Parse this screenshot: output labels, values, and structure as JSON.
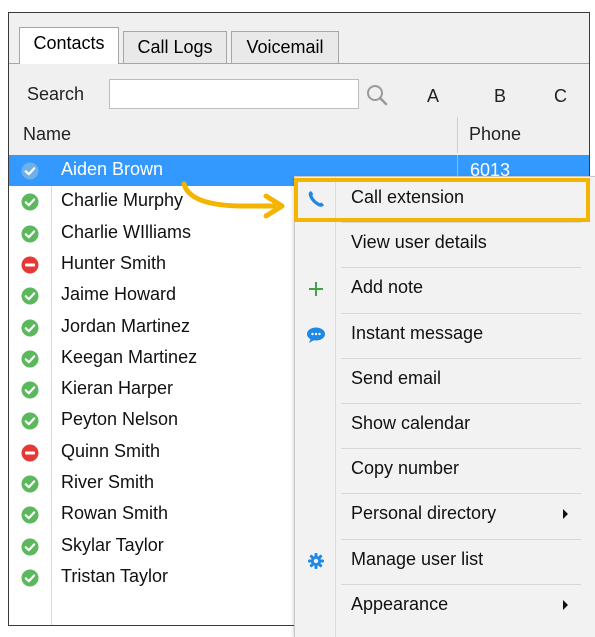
{
  "tabs": [
    {
      "label": "Contacts",
      "active": true
    },
    {
      "label": "Call Logs",
      "active": false
    },
    {
      "label": "Voicemail",
      "active": false
    }
  ],
  "search": {
    "label": "Search",
    "value": "",
    "placeholder": ""
  },
  "alphabet_index": [
    "A",
    "B",
    "C"
  ],
  "columns": {
    "name": "Name",
    "phone": "Phone"
  },
  "contacts": [
    {
      "name": "Aiden Brown",
      "status": "available",
      "phone": "6013",
      "selected": true
    },
    {
      "name": "Charlie Murphy",
      "status": "available"
    },
    {
      "name": "Charlie WIlliams",
      "status": "available"
    },
    {
      "name": "Hunter Smith",
      "status": "busy"
    },
    {
      "name": "Jaime Howard",
      "status": "available"
    },
    {
      "name": "Jordan Martinez",
      "status": "available"
    },
    {
      "name": "Keegan Martinez",
      "status": "available"
    },
    {
      "name": "Kieran Harper",
      "status": "available"
    },
    {
      "name": "Peyton Nelson",
      "status": "available"
    },
    {
      "name": "Quinn Smith",
      "status": "busy"
    },
    {
      "name": "River Smith",
      "status": "available"
    },
    {
      "name": "Rowan Smith",
      "status": "available"
    },
    {
      "name": "Skylar Taylor",
      "status": "available"
    },
    {
      "name": "Tristan Taylor",
      "status": "available"
    }
  ],
  "context_menu": {
    "items": [
      {
        "label": "Call extension",
        "icon": "phone-icon",
        "highlighted": true
      },
      {
        "label": "View user details",
        "icon": null
      },
      {
        "label": "Add note",
        "icon": "plus-icon"
      },
      {
        "label": "Instant message",
        "icon": "chat-bubble-icon"
      },
      {
        "label": "Send email",
        "icon": null
      },
      {
        "label": "Show calendar",
        "icon": null
      },
      {
        "label": "Copy number",
        "icon": null
      },
      {
        "label": "Personal directory",
        "icon": null,
        "submenu": true
      },
      {
        "label": "Manage user list",
        "icon": "gear-icon"
      },
      {
        "label": "Appearance",
        "icon": null,
        "submenu": true
      }
    ]
  },
  "colors": {
    "selection": "#3399ff",
    "available": "#5cb85c",
    "busy": "#e53935",
    "highlight": "#f5b400",
    "phone_icon": "#1e88e5",
    "plus_icon": "#43a047",
    "chat_icon": "#1e88e5",
    "gear_icon": "#1e88e5"
  }
}
